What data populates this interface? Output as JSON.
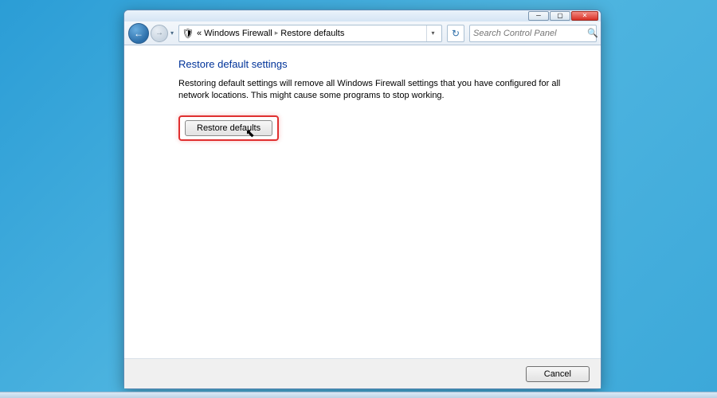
{
  "breadcrumb": {
    "prefix": "«",
    "item1": "Windows Firewall",
    "item2": "Restore defaults"
  },
  "search": {
    "placeholder": "Search Control Panel"
  },
  "page": {
    "heading": "Restore default settings",
    "description": "Restoring default settings will remove all Windows Firewall settings that you have configured for all network locations. This might cause some programs to stop working.",
    "restore_label": "Restore defaults",
    "cancel_label": "Cancel"
  },
  "icons": {
    "back": "←",
    "forward": "→",
    "chevron": "▾",
    "sep": "▸",
    "refresh": "↻",
    "search": "🔍",
    "min": "─",
    "max": "▢",
    "close": "✕",
    "shield": "🛡",
    "cursor": "↖"
  }
}
